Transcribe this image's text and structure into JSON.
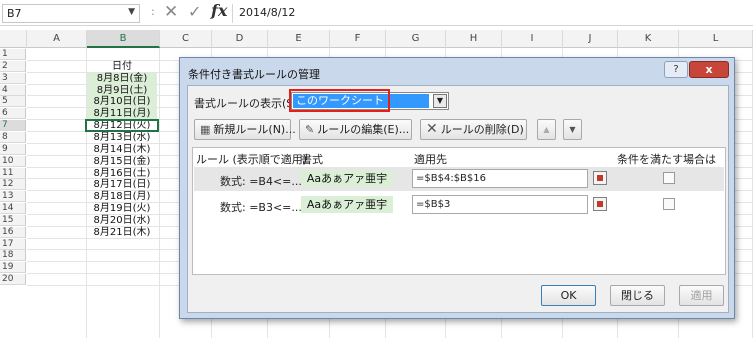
{
  "formula_bar": {
    "name_box": "B7",
    "separator": ":",
    "cancel_glyph": "✕",
    "enter_glyph": "✓",
    "fx": "fx",
    "formula": "2014/8/12"
  },
  "sheet": {
    "columns": [
      "A",
      "B",
      "C",
      "D",
      "E",
      "F",
      "G",
      "H",
      "I",
      "J",
      "K",
      "L"
    ],
    "selected_column": "B",
    "rows": [
      "1",
      "2",
      "3",
      "4",
      "5",
      "6",
      "7",
      "8",
      "9",
      "10",
      "11",
      "12",
      "13",
      "14",
      "15",
      "16",
      "17",
      "18",
      "19",
      "20"
    ],
    "selected_row": "7",
    "b_header": "日付",
    "b_values": [
      "8月8日(金)",
      "8月9日(土)",
      "8月10日(日)",
      "8月11日(月)",
      "8月12日(火)",
      "8月13日(水)",
      "8月14日(木)",
      "8月15日(金)",
      "8月16日(土)",
      "8月17日(日)",
      "8月18日(月)",
      "8月19日(火)",
      "8月20日(水)",
      "8月21日(木)"
    ],
    "fill_color": "#dbeed6",
    "accent_color": "#217346"
  },
  "dialog": {
    "title": "条件付き書式ルールの管理",
    "help_glyph": "?",
    "close_glyph": "x",
    "show_label": "書式ルールの表示(S):",
    "show_value": "このワークシート",
    "toolbar": {
      "new_icon": "new-rule-icon",
      "new_label": "新規ルール(N)...",
      "edit_icon": "edit-rule-icon",
      "edit_label": "ルールの編集(E)...",
      "delete_label": "ルールの削除(D)",
      "delete_glyph": "✕",
      "up_glyph": "▲",
      "down_glyph": "▼"
    },
    "headers": {
      "rule": "ルール (表示順で適用)",
      "format": "書式",
      "applies": "適用先",
      "stop": "条件を満たす場合は停止"
    },
    "rules": [
      {
        "condition": "数式: =B4<=...",
        "preview": "Aaあぁアァ亜宇",
        "applies_to": "=$B$4:$B$16",
        "stop": false
      },
      {
        "condition": "数式: =B3<=...",
        "preview": "Aaあぁアァ亜宇",
        "applies_to": "=$B$3",
        "stop": false
      }
    ],
    "footer": {
      "ok": "OK",
      "close": "閉じる",
      "apply": "適用"
    },
    "highlight_color": "#e5201a",
    "title_bar_color": "#c9d8ea"
  }
}
